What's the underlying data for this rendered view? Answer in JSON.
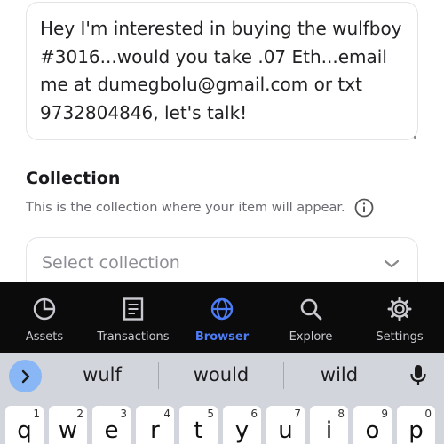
{
  "description": {
    "text": "Hey I'm interested in buying the wulfboy #3016...would you take .07 Eth...email me at dumegbolu@gmail.com or txt 9732804846, let's talk!"
  },
  "collection": {
    "title": "Collection",
    "help": "This is the collection where your item will appear.",
    "select_placeholder": "Select collection"
  },
  "nav": {
    "items": [
      {
        "label": "Assets",
        "icon": "pie-chart-icon"
      },
      {
        "label": "Transactions",
        "icon": "document-icon"
      },
      {
        "label": "Browser",
        "icon": "globe-icon",
        "active": true
      },
      {
        "label": "Explore",
        "icon": "search-icon"
      },
      {
        "label": "Settings",
        "icon": "gear-icon"
      }
    ],
    "active_color": "#4d7cf7",
    "background": "#0b0b0c"
  },
  "keyboard": {
    "suggestions": [
      "wulf",
      "would",
      "wild"
    ],
    "keys": [
      {
        "char": "q",
        "num": "1"
      },
      {
        "char": "w",
        "num": "2"
      },
      {
        "char": "e",
        "num": "3"
      },
      {
        "char": "r",
        "num": "4"
      },
      {
        "char": "t",
        "num": "5"
      },
      {
        "char": "y",
        "num": "6"
      },
      {
        "char": "u",
        "num": "7"
      },
      {
        "char": "i",
        "num": "8"
      },
      {
        "char": "o",
        "num": "9"
      },
      {
        "char": "p",
        "num": "0"
      }
    ]
  }
}
